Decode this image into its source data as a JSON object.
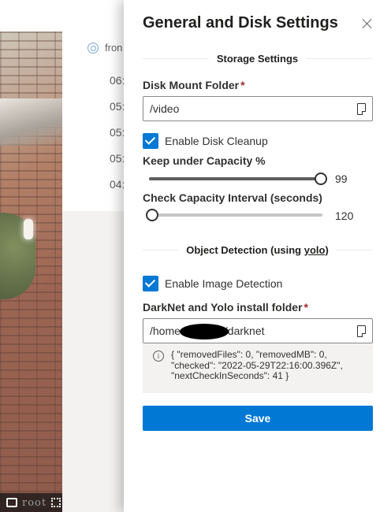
{
  "background": {
    "source_label": "fron",
    "times": [
      "06:",
      "05:",
      "05:",
      "05:",
      "04:"
    ],
    "toolbar_text": "root"
  },
  "panel": {
    "title": "General and Disk Settings",
    "storage_section": "Storage Settings",
    "disk_mount": {
      "label": "Disk Mount Folder",
      "required_mark": "*",
      "value": "/video"
    },
    "disk_cleanup": {
      "label": "Enable Disk Cleanup",
      "checked": true
    },
    "capacity": {
      "label": "Keep under Capacity %",
      "value": "99",
      "min": 0,
      "max": 100,
      "level": 99
    },
    "interval": {
      "label": "Check Capacity Interval (seconds)",
      "value": "120",
      "min": 60,
      "max": 3600,
      "level": 120
    },
    "object_section": {
      "prefix": "Object Detection (using ",
      "link": "yolo",
      "suffix": ")"
    },
    "image_detection": {
      "label": "Enable Image Detection",
      "checked": true
    },
    "darknet": {
      "label": "DarkNet and Yolo install folder",
      "required_mark": "*",
      "value_start": "/home",
      "value_end": "/darknet"
    },
    "status": {
      "line1": "{ \"removedFiles\": 0, \"removedMB\": 0,",
      "line2": "\"checked\": \"2022-05-29T22:16:00.396Z\",",
      "line3": "\"nextCheckInSeconds\": 41 }"
    },
    "save_label": "Save"
  },
  "colors": {
    "primary": "#0078d4",
    "required": "#a4262c"
  }
}
